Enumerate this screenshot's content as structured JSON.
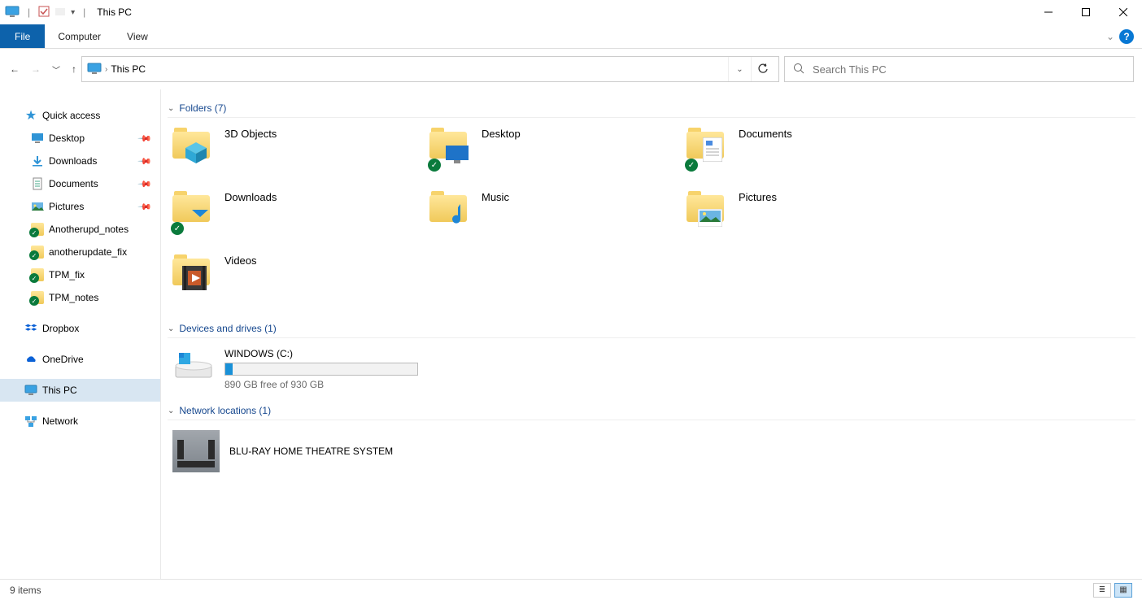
{
  "window": {
    "title": "This PC"
  },
  "ribbon": {
    "file": "File",
    "tabs": [
      "Computer",
      "View"
    ]
  },
  "address": {
    "location": "This PC",
    "search_placeholder": "Search This PC"
  },
  "sidebar": {
    "quick_access": {
      "label": "Quick access",
      "items": [
        {
          "label": "Desktop",
          "pinned": true,
          "icon": "desktop"
        },
        {
          "label": "Downloads",
          "pinned": true,
          "icon": "downloads"
        },
        {
          "label": "Documents",
          "pinned": true,
          "icon": "documents"
        },
        {
          "label": "Pictures",
          "pinned": true,
          "icon": "pictures"
        },
        {
          "label": "Anotherupd_notes",
          "pinned": false,
          "icon": "folder-sync"
        },
        {
          "label": "anotherupdate_fix",
          "pinned": false,
          "icon": "folder-sync"
        },
        {
          "label": "TPM_fix",
          "pinned": false,
          "icon": "folder-sync"
        },
        {
          "label": "TPM_notes",
          "pinned": false,
          "icon": "folder-sync"
        }
      ]
    },
    "roots": [
      {
        "label": "Dropbox",
        "icon": "dropbox"
      },
      {
        "label": "OneDrive",
        "icon": "onedrive"
      },
      {
        "label": "This PC",
        "icon": "this-pc",
        "selected": true
      },
      {
        "label": "Network",
        "icon": "network"
      }
    ]
  },
  "groups": {
    "folders": {
      "header": "Folders (7)",
      "items": [
        {
          "label": "3D Objects",
          "icon": "3dobjects",
          "sync": false
        },
        {
          "label": "Desktop",
          "icon": "desktop",
          "sync": true
        },
        {
          "label": "Documents",
          "icon": "documents",
          "sync": true
        },
        {
          "label": "Downloads",
          "icon": "downloads",
          "sync": true
        },
        {
          "label": "Music",
          "icon": "music",
          "sync": false
        },
        {
          "label": "Pictures",
          "icon": "pictures",
          "sync": false
        },
        {
          "label": "Videos",
          "icon": "videos",
          "sync": false
        }
      ]
    },
    "drives": {
      "header": "Devices and drives (1)",
      "items": [
        {
          "label": "WINDOWS (C:)",
          "free_text": "890 GB free of 930 GB",
          "used_pct": 4
        }
      ]
    },
    "network": {
      "header": "Network locations (1)",
      "items": [
        {
          "label": "BLU-RAY HOME THEATRE SYSTEM"
        }
      ]
    }
  },
  "status": {
    "text": "9 items"
  }
}
